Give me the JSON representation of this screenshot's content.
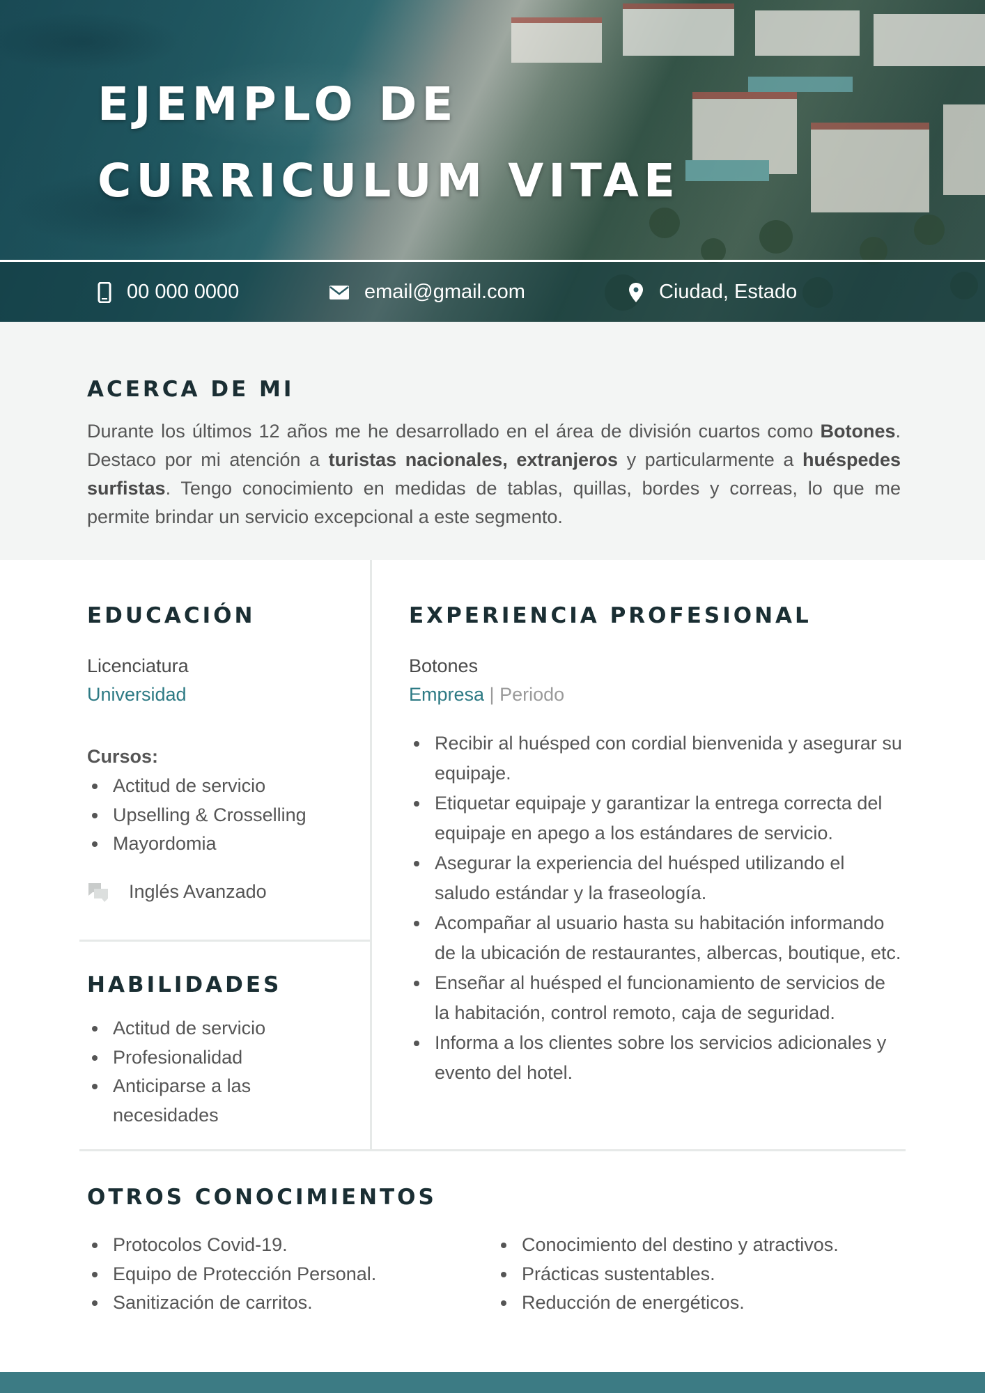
{
  "header": {
    "title_line1": "EJEMPLO DE",
    "title_line2": "CURRICULUM VITAE",
    "phone": "00 000 0000",
    "email": "email@gmail.com",
    "location": "Ciudad, Estado"
  },
  "about": {
    "heading": "ACERCA DE MI",
    "p1": "Durante los últimos 12 años me he desarrollado en el área de división cuartos como ",
    "b1": "Botones",
    "p2": ". Destaco por mi atención a ",
    "b2": "turistas nacionales, extranjeros",
    "p3": " y particularmente a ",
    "b3": "huéspedes surfistas",
    "p4": ". Tengo conocimiento en medidas de tablas, quillas, bordes y correas, lo que me permite brindar un servicio excepcional a este segmento."
  },
  "education": {
    "heading": "EDUCACIÓN",
    "degree": "Licenciatura",
    "school": "Universidad",
    "courses_label": "Cursos:",
    "courses": [
      "Actitud de servicio",
      "Upselling & Crosselling",
      "Mayordomia"
    ],
    "language": "Inglés Avanzado"
  },
  "skills": {
    "heading": "HABILIDADES",
    "items": [
      "Actitud de servicio",
      "Profesionalidad",
      "Anticiparse a las necesidades"
    ]
  },
  "experience": {
    "heading": "EXPERIENCIA PROFESIONAL",
    "role": "Botones",
    "company": "Empresa",
    "separator": " | ",
    "period": "Periodo",
    "duties": [
      "Recibir al huésped con cordial bienvenida y asegurar su equipaje.",
      "Etiquetar equipaje y garantizar la entrega correcta del equipaje en apego a los estándares de servicio.",
      "Asegurar la experiencia del huésped utilizando el saludo estándar y la fraseología.",
      "Acompañar al usuario hasta su habitación informando de la ubicación de restaurantes, albercas, boutique, etc.",
      "Enseñar al huésped el funcionamiento de servicios de la habitación, control remoto, caja de seguridad.",
      "Informa a los clientes sobre los servicios adicionales y evento del hotel."
    ]
  },
  "other": {
    "heading": "OTROS CONOCIMIENTOS",
    "col1": [
      "Protocolos Covid-19.",
      "Equipo de Protección Personal.",
      "Sanitización de carritos."
    ],
    "col2": [
      "Conocimiento del destino y atractivos.",
      "Prácticas sustentables.",
      "Reducción de energéticos."
    ]
  },
  "colors": {
    "accent": "#2d7a84",
    "footer": "#3c7b84",
    "heading": "#1a2e33",
    "about_bg": "#f3f5f4"
  },
  "icons": {
    "phone": "phone-icon",
    "email": "email-icon",
    "location": "location-pin-icon",
    "language": "chat-bubbles-icon"
  }
}
